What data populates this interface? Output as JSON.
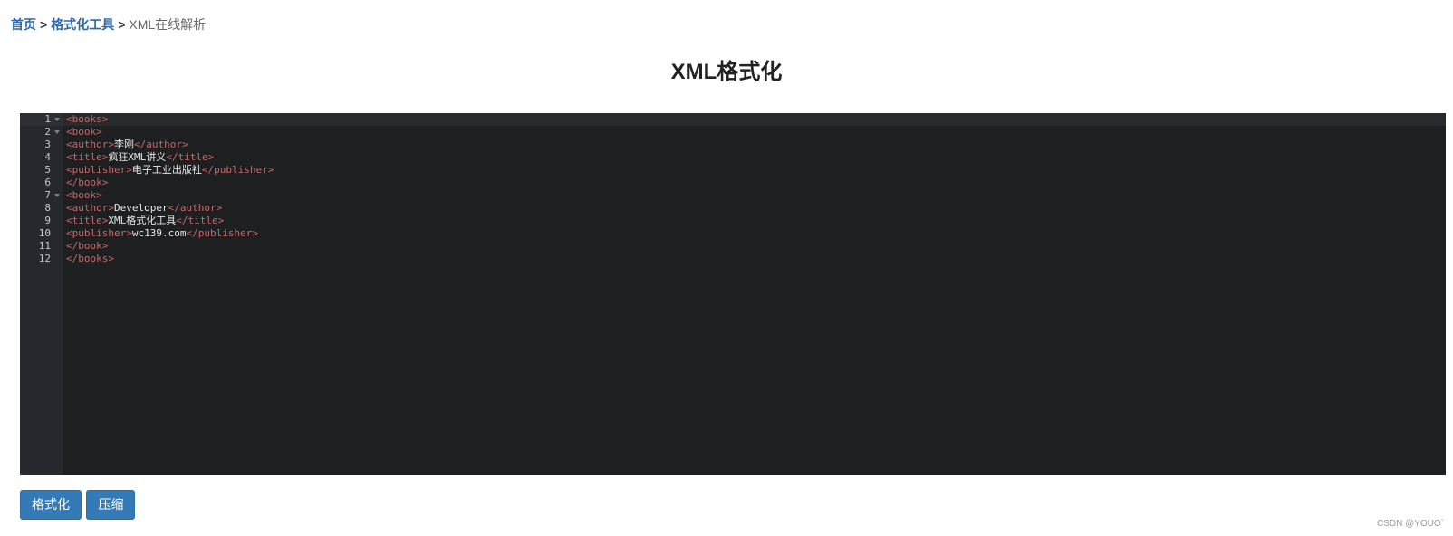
{
  "breadcrumb": {
    "home": "首页",
    "separator": ">",
    "tools": "格式化工具",
    "current": "XML在线解析"
  },
  "page_title": "XML格式化",
  "editor": {
    "lines": [
      {
        "num": "1",
        "fold": true,
        "tokens": [
          {
            "t": "tag",
            "v": "<books>"
          }
        ]
      },
      {
        "num": "2",
        "fold": true,
        "tokens": [
          {
            "t": "tag",
            "v": "<book>"
          }
        ]
      },
      {
        "num": "3",
        "fold": false,
        "tokens": [
          {
            "t": "tag",
            "v": "<author>"
          },
          {
            "t": "txt",
            "v": "李刚"
          },
          {
            "t": "tag",
            "v": "</author>"
          }
        ]
      },
      {
        "num": "4",
        "fold": false,
        "tokens": [
          {
            "t": "tag",
            "v": "<title>"
          },
          {
            "t": "txt",
            "v": "疯狂XML讲义"
          },
          {
            "t": "tag",
            "v": "</title>"
          }
        ]
      },
      {
        "num": "5",
        "fold": false,
        "tokens": [
          {
            "t": "tag",
            "v": "<publisher>"
          },
          {
            "t": "txt",
            "v": "电子工业出版社"
          },
          {
            "t": "tag",
            "v": "</publisher>"
          }
        ]
      },
      {
        "num": "6",
        "fold": false,
        "tokens": [
          {
            "t": "tag",
            "v": "</book>"
          }
        ]
      },
      {
        "num": "7",
        "fold": true,
        "tokens": [
          {
            "t": "tag",
            "v": "<book>"
          }
        ]
      },
      {
        "num": "8",
        "fold": false,
        "tokens": [
          {
            "t": "tag",
            "v": "<author>"
          },
          {
            "t": "txt",
            "v": "Developer"
          },
          {
            "t": "tag",
            "v": "</author>"
          }
        ]
      },
      {
        "num": "9",
        "fold": false,
        "tokens": [
          {
            "t": "tag",
            "v": "<title>"
          },
          {
            "t": "txt",
            "v": "XML格式化工具"
          },
          {
            "t": "tag",
            "v": "</title>"
          }
        ]
      },
      {
        "num": "10",
        "fold": false,
        "tokens": [
          {
            "t": "tag",
            "v": "<publisher>"
          },
          {
            "t": "txt",
            "v": "wc139.com"
          },
          {
            "t": "tag",
            "v": "</publisher>"
          }
        ]
      },
      {
        "num": "11",
        "fold": false,
        "tokens": [
          {
            "t": "tag",
            "v": "</book>"
          }
        ]
      },
      {
        "num": "12",
        "fold": false,
        "tokens": [
          {
            "t": "tag",
            "v": "</books>"
          }
        ]
      }
    ]
  },
  "buttons": {
    "format_label": "格式化",
    "compress_label": "压缩"
  },
  "colors": {
    "tag": "#cc6666",
    "text": "#e8e8e8",
    "editor_bg": "#1d1f21",
    "button_bg": "#337ab7",
    "link": "#2a6aad"
  },
  "watermark": "CSDN @YOUO`"
}
